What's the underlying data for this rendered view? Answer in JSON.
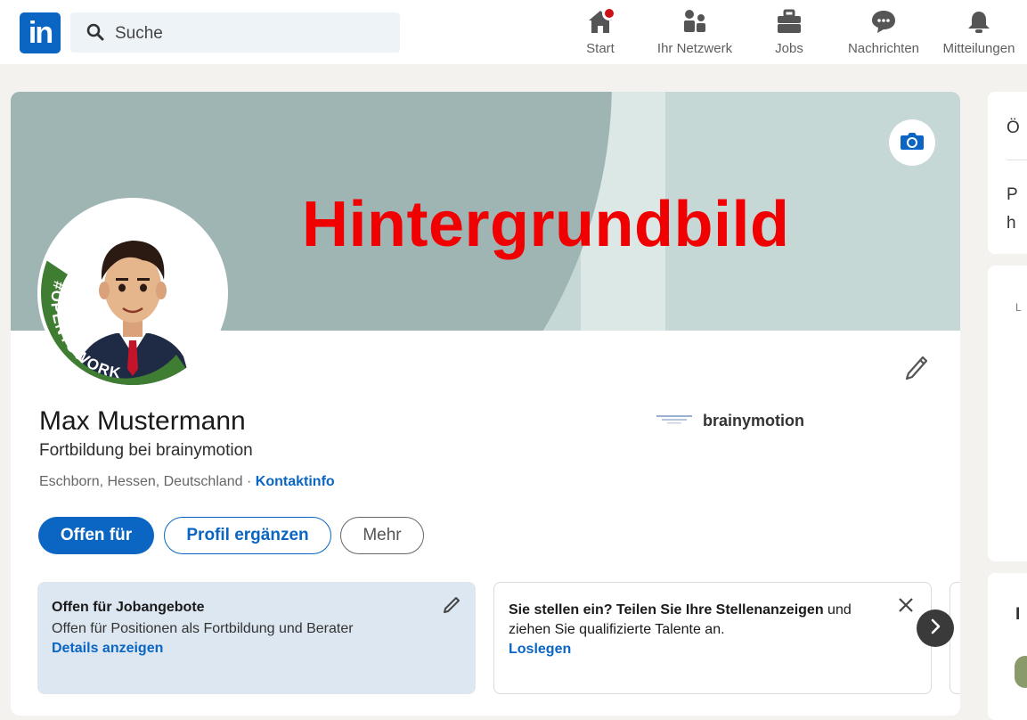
{
  "nav": {
    "logo": "in",
    "search_placeholder": "Suche",
    "items": [
      {
        "label": "Start",
        "icon": "home-icon"
      },
      {
        "label": "Ihr Netzwerk",
        "icon": "network-icon"
      },
      {
        "label": "Jobs",
        "icon": "briefcase-icon"
      },
      {
        "label": "Nachrichten",
        "icon": "messaging-icon"
      },
      {
        "label": "Mitteilungen",
        "icon": "bell-icon"
      }
    ]
  },
  "profile": {
    "banner_label": "Hintergrundbild",
    "avatar_badge": "#OPENTOWORK",
    "name": "Max Mustermann",
    "headline": "Fortbildung bei brainymotion",
    "location": "Eschborn, Hessen, Deutschland",
    "location_sep": " · ",
    "contact_link": "Kontaktinfo",
    "company": "brainymotion",
    "company_logo_text": "brainymotion",
    "buttons": {
      "open_to": "Offen für",
      "add_section": "Profil ergänzen",
      "more": "Mehr"
    }
  },
  "open_to_work": {
    "title": "Offen für Jobangebote",
    "text": "Offen für Positionen als Fortbildung und Berater",
    "link": "Details anzeigen"
  },
  "hiring": {
    "text_bold": "Sie stellen ein? Teilen Sie Ihre Stellenanzeigen",
    "text_rest": " und ziehen Sie qualifizierte Talente an.",
    "link": "Loslegen"
  },
  "sidebar": {
    "letters": [
      "Ö",
      "P",
      "h",
      "L",
      "I"
    ]
  },
  "colors": {
    "brand": "#0a66c2",
    "banner_label": "#f00000",
    "opentowork_green": "#3f7d32"
  }
}
